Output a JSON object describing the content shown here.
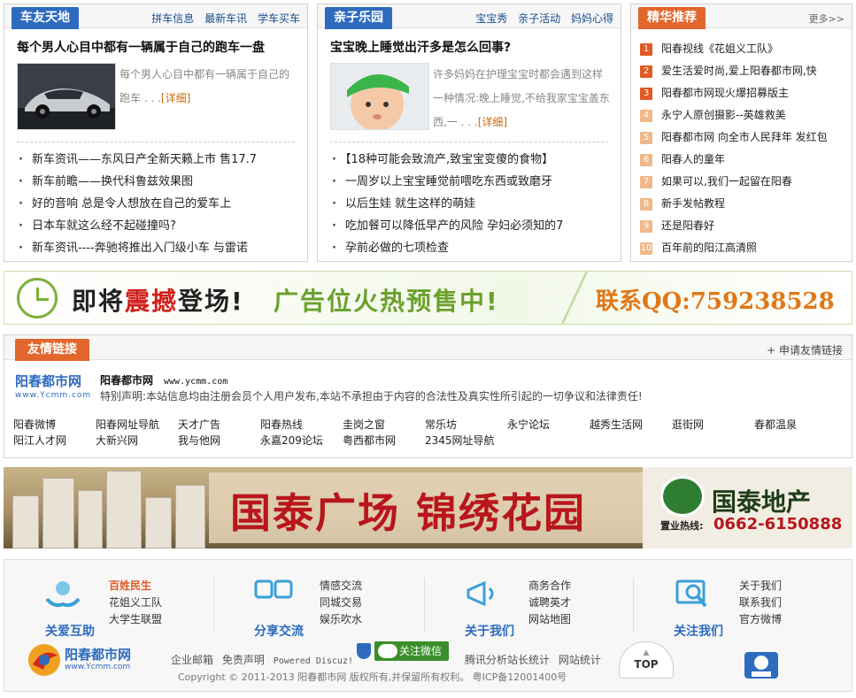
{
  "car": {
    "tab": "车友天地",
    "links": [
      "拼车信息",
      "最新车讯",
      "学车买车"
    ],
    "headline": "每个男人心目中都有一辆属于自己的跑车一盘",
    "summary": "每个男人心目中都有一辆属于自己的跑车 . . .",
    "more": "[详细]",
    "news": [
      "新车资讯——东风日产全新天籁上市 售17.7",
      "新车前瞻——换代科鲁兹效果图",
      "好的音响 总是令人想放在自己的爱车上",
      "日本车就这么经不起碰撞吗?",
      "新车资讯----奔驰将推出入门级小车 与雷诺"
    ]
  },
  "parent": {
    "tab": "亲子乐园",
    "links": [
      "宝宝秀",
      "亲子活动",
      "妈妈心得"
    ],
    "headline": "宝宝晚上睡觉出汗多是怎么回事?",
    "summary": "许多妈妈在护理宝宝时都会遇到这样一种情况:晚上睡觉,不给我家宝宝盖东西,一 . . .",
    "more": "[详细]",
    "news": [
      "【18种可能会致流产,致宝宝变傻的食物】",
      "一周岁以上宝宝睡觉前喂吃东西或致磨牙",
      "以后生娃 就生这样的萌娃",
      "吃加餐可以降低早产的风险 孕妇必须知的7",
      "孕前必做的七项检查"
    ]
  },
  "featured": {
    "tab": "精华推荐",
    "more": "更多>>",
    "items": [
      "阳春视线《花姐义工队》",
      "爱生活爱时尚,爱上阳春都市网,快",
      "阳春都市网现火爆招募版主",
      "永宁人原创摄影--英雄救美",
      "阳春都市网 向全市人民拜年 发红包",
      "阳春人的童年",
      "如果可以,我们一起留在阳春",
      "新手发帖教程",
      "还是阳春好",
      "百年前的阳江高清照"
    ],
    "numbers": [
      "1",
      "2",
      "3",
      "4",
      "5",
      "6",
      "7",
      "8",
      "9",
      "10"
    ]
  },
  "ad1": {
    "left": "即将",
    "em": "震撼",
    "left2": "登场!",
    "middle": "广告位火热预售中!",
    "contact": "联系QQ:759238528"
  },
  "friends": {
    "tab": "友情链接",
    "apply": "+ 申请友情链接",
    "logo_text": "阳春都市网",
    "logo_url": "www.Ycmm.com",
    "site_name": "阳春都市网",
    "site_url": "www.ycmm.com",
    "notice": "特别声明:本站信息均由注册会员个人用户发布,本站不承担由于内容的合法性及真实性所引起的一切争议和法律责任!",
    "row1": [
      "阳春微博",
      "阳春网址导航",
      "天才广告",
      "阳春热线",
      "圭岗之窗",
      "常乐坊",
      "永宁论坛",
      "越秀生活网",
      "逛街网",
      "春都温泉"
    ],
    "row2": [
      "阳江人才网",
      "大新兴网",
      "我与他网",
      "永嘉209论坛",
      "粤西都市网",
      "2345网址导航"
    ]
  },
  "ad2": {
    "title": "国泰广场 锦绣花园",
    "brand": "国泰地产",
    "hotline_label": "置业热线:",
    "hotline": "0662-6150888"
  },
  "footer": {
    "groups": [
      {
        "label": "关爱互助",
        "items": [
          "百姓民生",
          "花姐义工队",
          "大学生联盟"
        ]
      },
      {
        "label": "分享交流",
        "items": [
          "情感交流",
          "同城交易",
          "娱乐吹水"
        ]
      },
      {
        "label": "关于我们",
        "items": [
          "商务合作",
          "诚聘英才",
          "网站地图"
        ]
      },
      {
        "label": "关注我们",
        "items": [
          "关于我们",
          "联系我们",
          "官方微博"
        ]
      }
    ],
    "logo_text": "阳春都市网",
    "logo_url": "www.Ycmm.com",
    "links": [
      "企业邮箱",
      "免责声明",
      "Powered Discuz!"
    ],
    "wechat": "关注微信",
    "stats": [
      "腾讯分析站长统计",
      "网站统计"
    ],
    "copyright": "Copyright © 2011-2013 阳春都市网 版权所有,并保留所有权利。 粤ICP备12001400号",
    "top": "TOP"
  }
}
